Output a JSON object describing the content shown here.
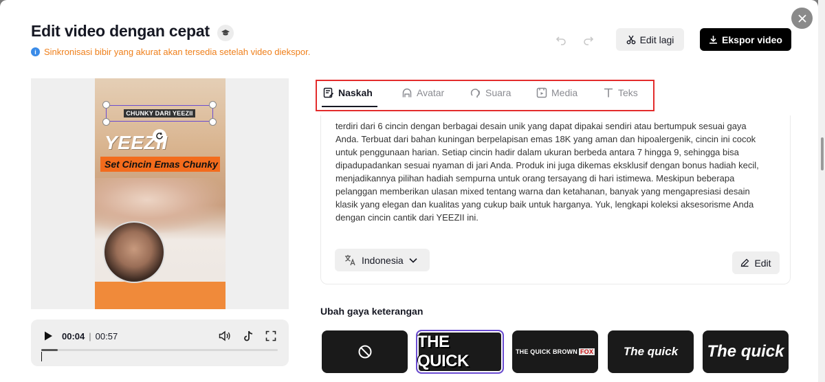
{
  "header": {
    "title": "Edit video dengan cepat",
    "info": "Sinkronisasi bibir yang akurat akan tersedia setelah video diekspor.",
    "edit_again_label": "Edit lagi",
    "export_label": "Ekspor video"
  },
  "preview": {
    "caption_chip": "CHUNKY DARI YEEZII",
    "brand": "YEEZII",
    "banner": "Set Cincin Emas Chunky"
  },
  "player": {
    "current_time": "00:04",
    "separator": "|",
    "duration": "00:57",
    "progress": 0.07
  },
  "tabs": [
    {
      "label": "Naskah",
      "icon": "script-icon"
    },
    {
      "label": "Avatar",
      "icon": "avatar-icon"
    },
    {
      "label": "Suara",
      "icon": "voice-icon"
    },
    {
      "label": "Media",
      "icon": "media-icon"
    },
    {
      "label": "Teks",
      "icon": "text-icon"
    }
  ],
  "script": {
    "lines": [
      "terdiri dari 6 cincin dengan berbagai desain unik yang dapat dipakai sendiri atau bertumpuk sesuai gaya",
      "Anda. Terbuat dari bahan kuningan berpelapisan emas 18K yang aman dan hipoalergenik, cincin ini cocok",
      "untuk penggunaan harian. Setiap cincin hadir dalam ukuran berbeda antara 7 hingga 9, sehingga bisa",
      "dipadupadankan sesuai nyaman di jari Anda. Produk ini juga dikemas eksklusif dengan bonus hadiah kecil,",
      "menjadikannya pilihan hadiah sempurna untuk orang tersayang di hari istimewa. Meskipun beberapa",
      "pelanggan memberikan ulasan mixed tentang warna dan ketahanan, banyak yang mengapresiasi desain",
      "klasik yang elegan dan kualitas yang cukup baik untuk harganya. Yuk, lengkapi koleksi aksesorisme Anda",
      "dengan cincin cantik dari YEEZII ini."
    ],
    "language": "Indonesia",
    "edit_label": "Edit"
  },
  "caption_styles": {
    "label": "Ubah gaya keterangan",
    "options": [
      "",
      "THE QUICK",
      "THE QUICK BROWN",
      "The quick",
      "The quick"
    ],
    "fox": "FOX",
    "selected_index": 1
  },
  "colors": {
    "accent": "#6a4bd1",
    "warning_text": "#ef7f1a",
    "highlight_border": "#e32b2b"
  }
}
